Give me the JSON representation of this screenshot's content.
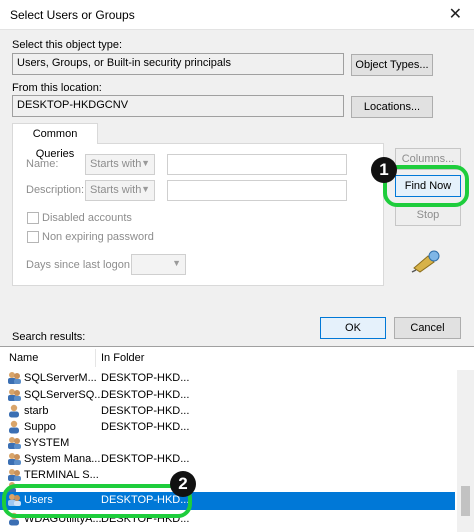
{
  "window": {
    "title": "Select Users or Groups",
    "close_glyph": "✕"
  },
  "object_type": {
    "label": "Select this object type:",
    "value": "Users, Groups, or Built-in security principals",
    "button": "Object Types..."
  },
  "location": {
    "label": "From this location:",
    "value": "DESKTOP-HKDGCNV",
    "button": "Locations..."
  },
  "common_queries": {
    "tab_label": "Common Queries",
    "name_label": "Name:",
    "name_mode": "Starts with",
    "description_label": "Description:",
    "description_mode": "Starts with",
    "disabled_accounts": "Disabled accounts",
    "non_expiring_password": "Non expiring password",
    "days_since_logon": "Days since last logon:"
  },
  "buttons": {
    "columns": "Columns...",
    "find_now": "Find Now",
    "stop": "Stop",
    "ok": "OK",
    "cancel": "Cancel"
  },
  "results": {
    "label": "Search results:",
    "columns": {
      "name": "Name",
      "folder": "In Folder"
    },
    "rows": [
      {
        "name": "SQLServerM...",
        "folder": "DESKTOP-HKD..."
      },
      {
        "name": "SQLServerSQ...",
        "folder": "DESKTOP-HKD..."
      },
      {
        "name": "starb",
        "folder": "DESKTOP-HKD..."
      },
      {
        "name": "Suppo",
        "folder": "DESKTOP-HKD..."
      },
      {
        "name": "SYSTEM",
        "folder": ""
      },
      {
        "name": "System Mana...",
        "folder": "DESKTOP-HKD..."
      },
      {
        "name": "TERMINAL S...",
        "folder": ""
      },
      {
        "name": "",
        "folder": ""
      },
      {
        "name": "Users",
        "folder": "DESKTOP-HKD...",
        "selected": true
      },
      {
        "name": "WDAGUtilityA...",
        "folder": "DESKTOP-HKD..."
      }
    ]
  },
  "annotations": {
    "step1": "1",
    "step2": "2",
    "color": "#1ecd3c"
  }
}
